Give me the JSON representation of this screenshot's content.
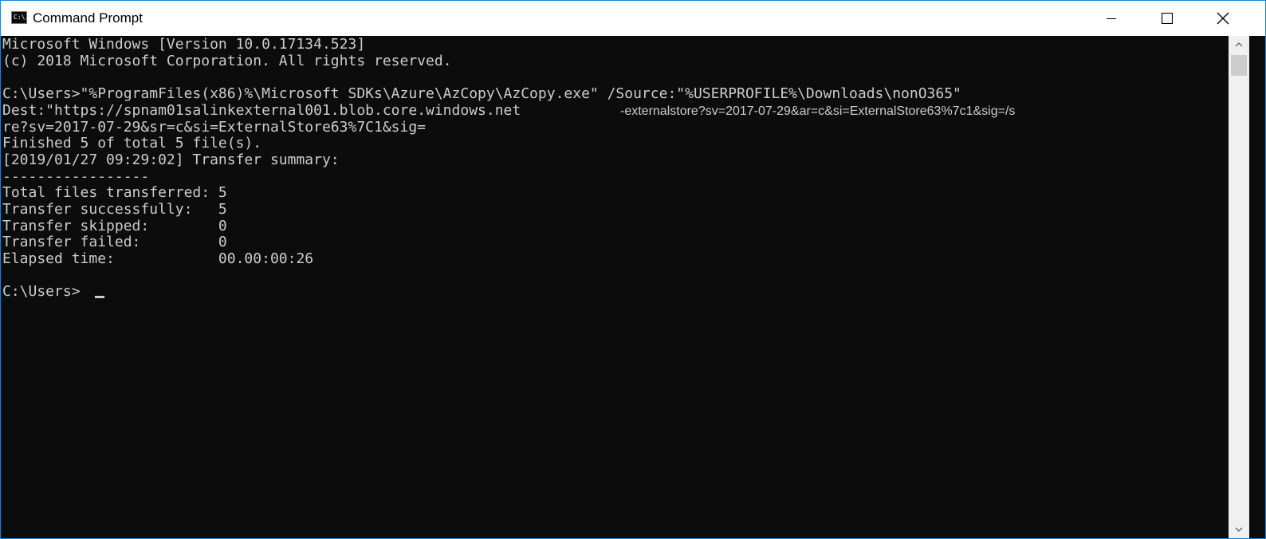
{
  "window": {
    "title": "Command Prompt",
    "icon": "console-app-icon",
    "icon_text": "C:\\."
  },
  "controls": {
    "minimize": "minimize-icon",
    "maximize": "maximize-icon",
    "close": "close-icon"
  },
  "console": {
    "lines": [
      "Microsoft Windows [Version 10.0.17134.523]",
      "(c) 2018 Microsoft Corporation. All rights reserved.",
      "",
      "C:\\Users>\"%ProgramFiles(x86)%\\Microsoft SDKs\\Azure\\AzCopy\\AzCopy.exe\" /Source:\"%USERPROFILE%\\Downloads\\nonO365\"",
      "Dest:\"https://spnam01salinkexternal001.blob.core.windows.net",
      "re?sv=2017-07-29&sr=c&si=ExternalStore63%7C1&sig=",
      "Finished 5 of total 5 file(s).",
      "[2019/01/27 09:29:02] Transfer summary:",
      "-----------------",
      "Total files transferred: 5",
      "Transfer successfully:   5",
      "Transfer skipped:        0",
      "Transfer failed:         0",
      "Elapsed time:            00.00:00:26",
      "",
      "C:\\Users>"
    ],
    "overlay_text": "-externalstore?sv=2017-07-29&ar=c&si=ExternalStore63%7c1&sig=/s",
    "colors": {
      "background": "#0c0c0c",
      "foreground": "#cccccc",
      "border": "#1883d7"
    }
  }
}
